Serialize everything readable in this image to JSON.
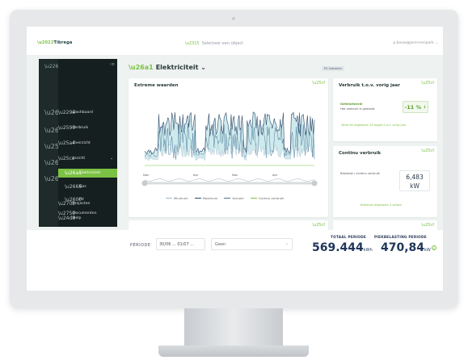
{
  "app": {
    "logo_text": "Tibrega",
    "search_placeholder": "Selecteer een object",
    "user": "p.bouw@jeninnenpark ⌄"
  },
  "nav": {
    "collapse": "‹≡",
    "rail_icons": [
      "menu-icon",
      "warning-icon",
      "person-icon",
      "grid-icon",
      "lamp-icon",
      "leaf-icon"
    ],
    "items": [
      {
        "label": "Dashboard",
        "icon": "dashboard-icon"
      },
      {
        "label": "Verbruik",
        "icon": "bar-chart-icon"
      },
      {
        "label": "Overzicht",
        "icon": "document-icon"
      },
      {
        "label": "Inzicht",
        "icon": "search-icon",
        "chevron": "⌄"
      },
      {
        "label": "Elektriciteit",
        "icon": "bolt-icon",
        "active": true
      },
      {
        "label": "Gas",
        "icon": "flame-icon"
      },
      {
        "label": "PV",
        "icon": "solar-icon"
      },
      {
        "label": "Documenten",
        "icon": "file-icon"
      },
      {
        "label": "Projecten",
        "icon": "hand-icon"
      },
      {
        "label": "Help",
        "icon": "info-icon"
      }
    ]
  },
  "page": {
    "title": "Elektriciteit ⌄",
    "badge": "PV inleveren"
  },
  "cards": {
    "extreme": {
      "title": "Extreme waarden",
      "legend": [
        "Minimum",
        "Maximum",
        "Actueel",
        "Continu verbruik"
      ],
      "x_ticks": [
        "Nov",
        "Apr",
        "Nov",
        "Apr"
      ]
    },
    "vorig_jaar": {
      "title": "Verbruik t.o.v. vorig jaar",
      "line1": "Gefeliciteerd!",
      "line2": "Het verbruik is gedaald.",
      "value": "-11 %",
      "arrow": "↓",
      "link": "Verbruik afgelopen 30 dagen t.o.v. vorig jaar"
    },
    "continu": {
      "title": "Continu verbruik",
      "label": "Basislast / continu verbruik",
      "value": "6,483",
      "unit": "kW",
      "link": "Basislast afgelopen 4 weken"
    }
  },
  "bottom": {
    "period_label": "PERIODE",
    "period_value": "30/06 ... 01/07 ...",
    "select_value": "Geen",
    "select_chevron": "⌄",
    "totaal_label": "TOTAAL PERIODE",
    "totaal_value": "569.444",
    "totaal_unit": "kWh",
    "piek_label": "PIEKBELASTING PERIODE",
    "piek_value": "470,84",
    "piek_unit": "kW",
    "info": "i"
  },
  "colors": {
    "brand_green": "#7bc143",
    "dark_nav": "#161f1f",
    "chart_max": "#2d4a6a",
    "chart_fill": "#a8d8de"
  }
}
